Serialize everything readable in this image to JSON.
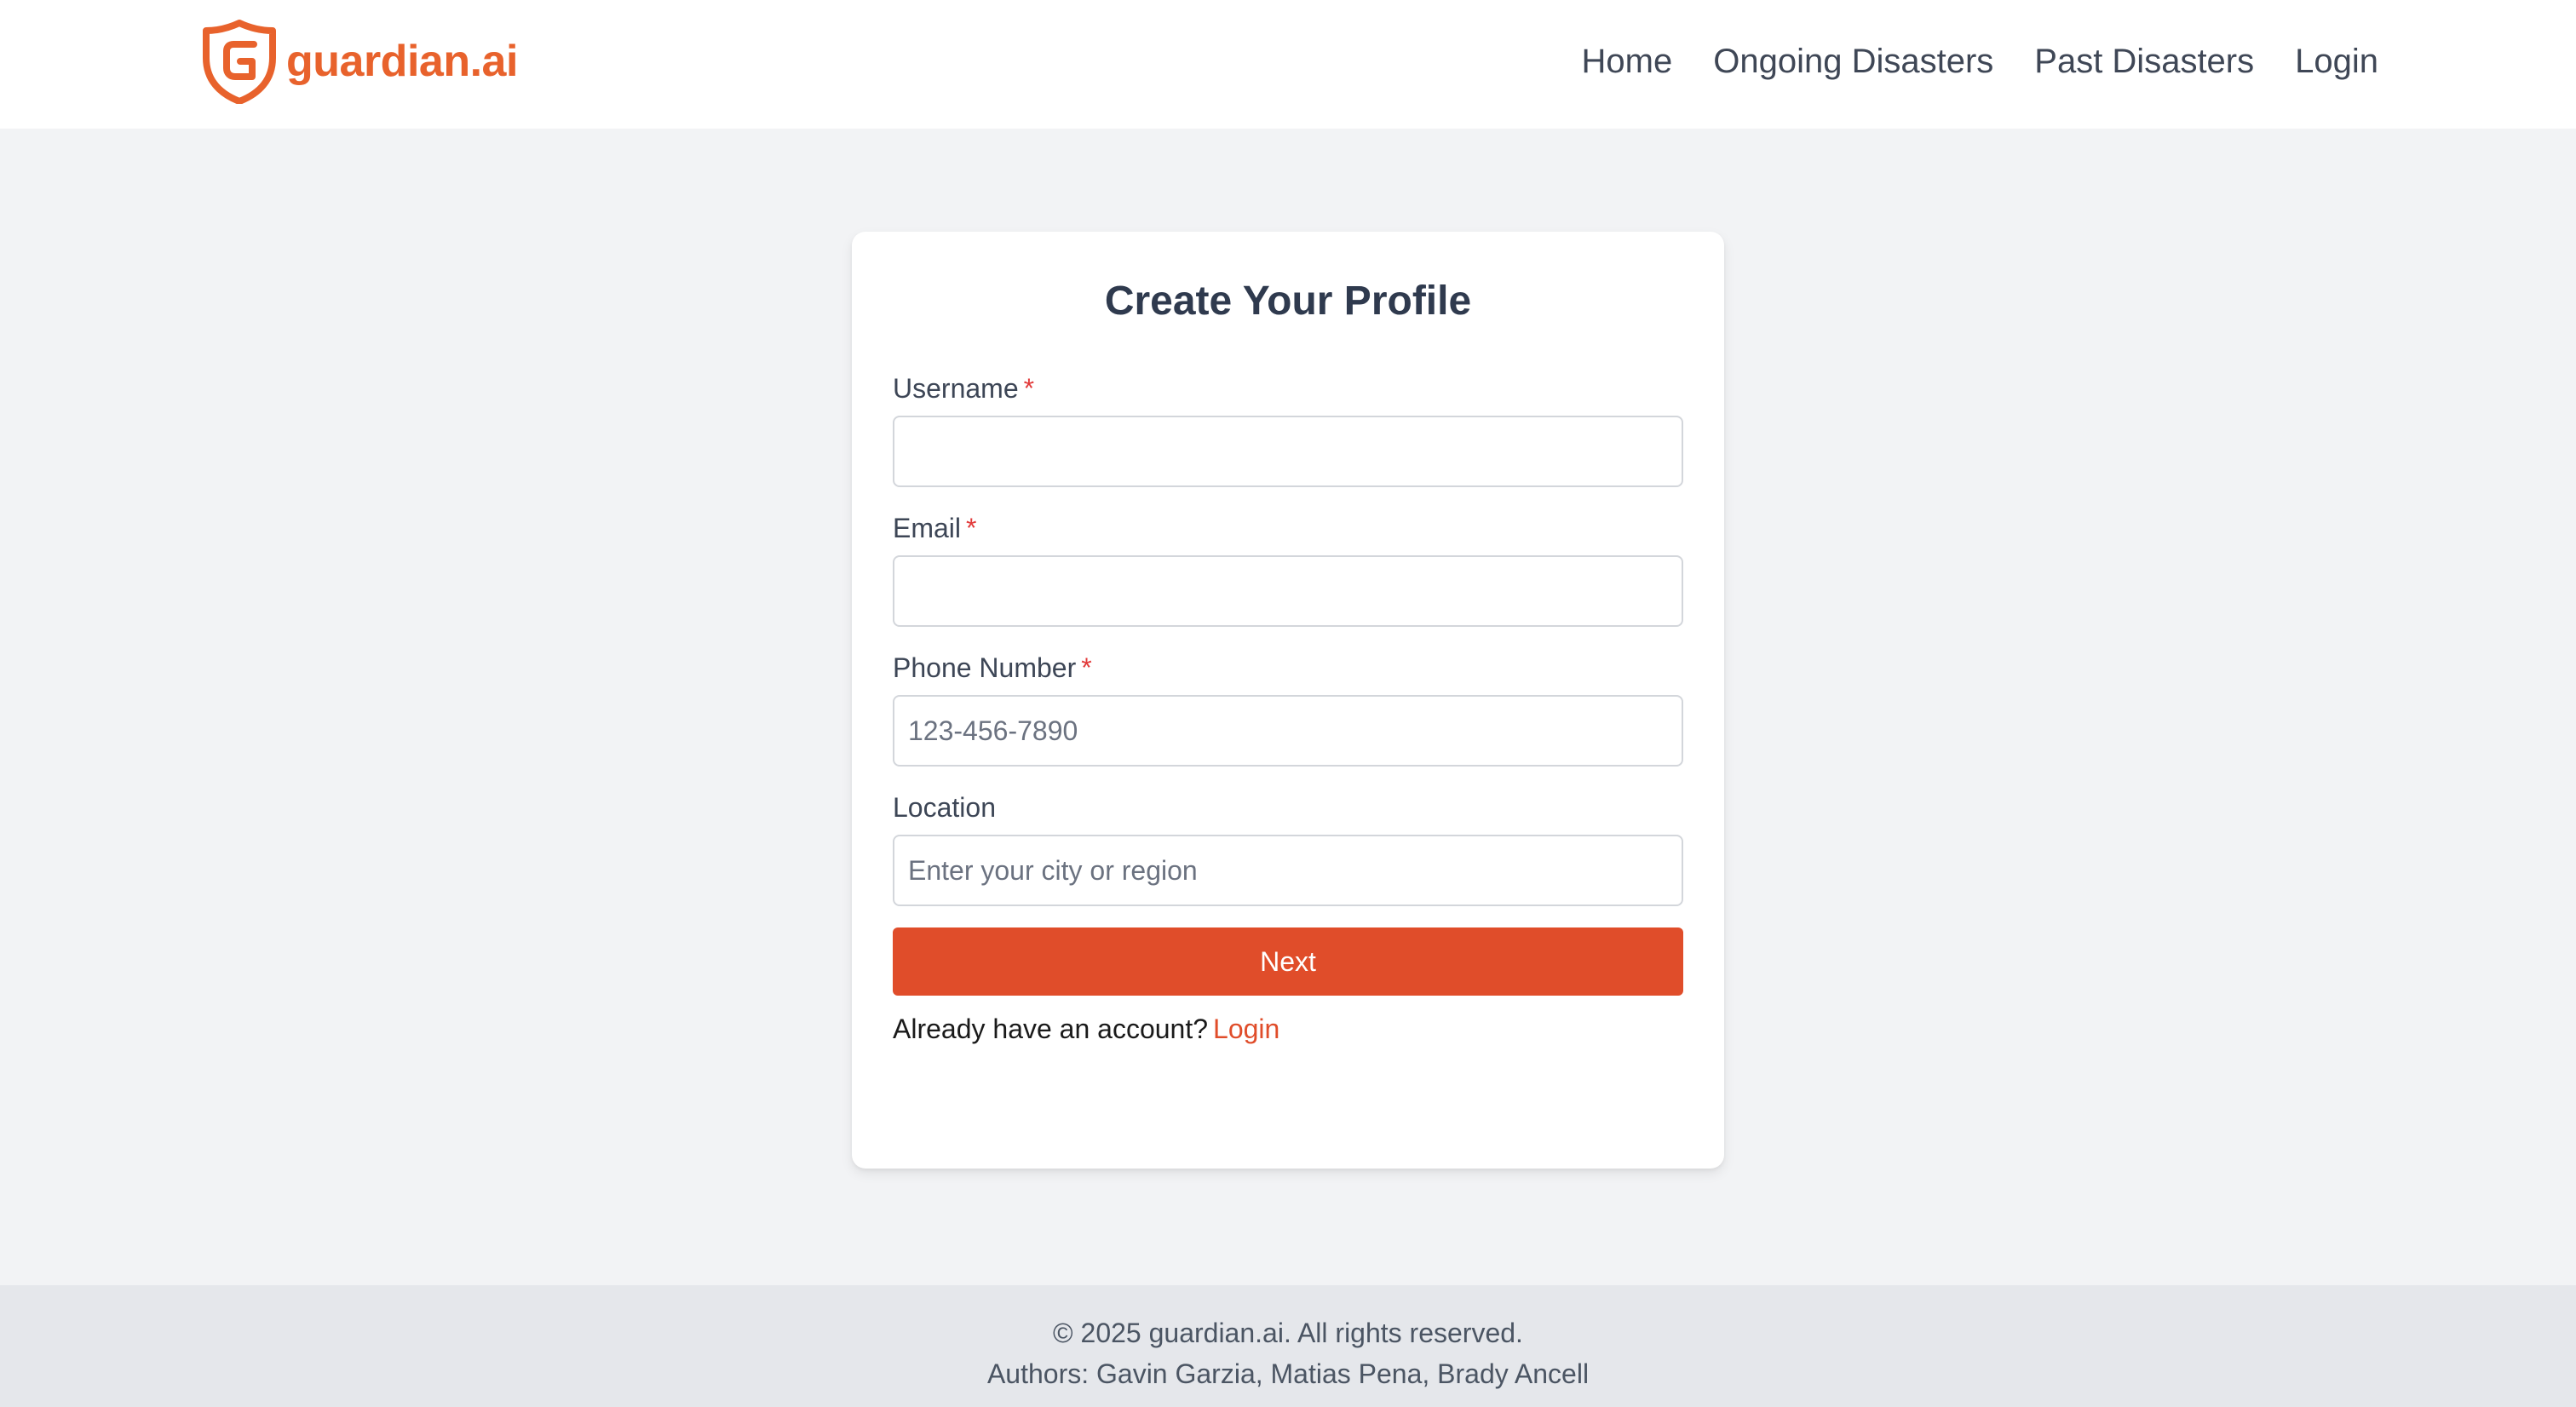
{
  "brand": {
    "name": "guardian.ai",
    "color": "#e8622c",
    "logo_icon": "shield-icon"
  },
  "nav": {
    "items": [
      {
        "label": "Home"
      },
      {
        "label": "Ongoing Disasters"
      },
      {
        "label": "Past Disasters"
      },
      {
        "label": "Login"
      }
    ]
  },
  "form": {
    "title": "Create Your Profile",
    "required_marker": "*",
    "fields": [
      {
        "label": "Username",
        "required": true,
        "value": "",
        "placeholder": ""
      },
      {
        "label": "Email",
        "required": true,
        "value": "",
        "placeholder": ""
      },
      {
        "label": "Phone Number",
        "required": true,
        "value": "",
        "placeholder": "123-456-7890"
      },
      {
        "label": "Location",
        "required": false,
        "value": "",
        "placeholder": "Enter your city or region"
      }
    ],
    "submit_label": "Next",
    "submit_color": "#e04d2a",
    "login_prompt": "Already have an account?",
    "login_link": "Login"
  },
  "footer": {
    "copyright": "© 2025 guardian.ai. All rights reserved.",
    "authors": "Authors: Gavin Garzia, Matias Pena, Brady Ancell"
  }
}
